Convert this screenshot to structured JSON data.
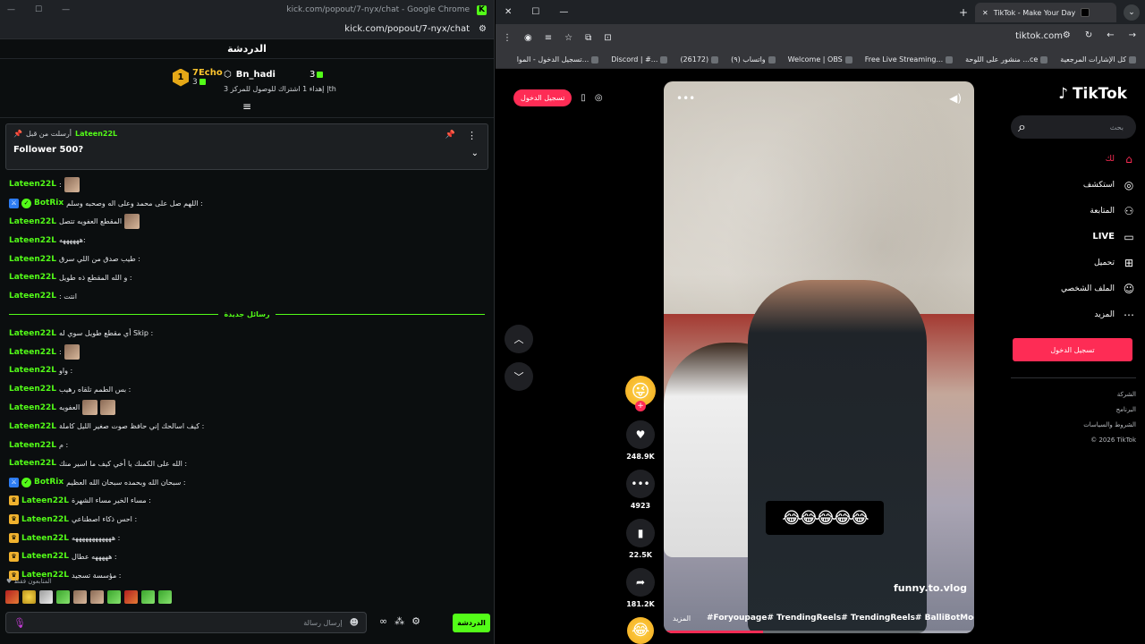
{
  "left": {
    "titlebar": {
      "url_title": "kick.com/popout/7-nyx/chat - Google Chrome",
      "favicon": "K"
    },
    "urlbar": {
      "url": "kick.com/popout/7-nyx/chat"
    },
    "header": {
      "title": "الدردشة"
    },
    "leaderboard": {
      "first": {
        "rank": "1",
        "name": "7Echo",
        "count": "3"
      },
      "second": {
        "name": "Bn_hadi"
      },
      "third": {
        "count": "3"
      },
      "info": "إهداء 1 اشتراك للوصول للمركز 3 |th"
    },
    "pinned": {
      "label": "أرسلت من قبل",
      "user": "Lateen22L",
      "message": "Follower 500?"
    },
    "messages": [
      {
        "user": "Lateen22L",
        "text": ":",
        "emotes": 1
      },
      {
        "user": "BotRix",
        "text": "اللهم صل على محمد وعلى اله وصحبه وسلم :",
        "bot": true
      },
      {
        "user": "Lateen22L",
        "text": "المقطع العفويه تتصل ",
        "emotes": 1
      },
      {
        "user": "Lateen22L",
        "text": "ههههههه:"
      },
      {
        "user": "Lateen22L",
        "text": "طيب صدق من اللي سرق :"
      },
      {
        "user": "Lateen22L",
        "text": "و الله المقطع ذه طويل :"
      },
      {
        "user": "Lateen22L",
        "text": ": انتت"
      },
      {
        "divider": "رسائل جديدة"
      },
      {
        "user": "Lateen22L",
        "text": "أي مقطع طويل سوي له Skip :"
      },
      {
        "user": "Lateen22L",
        "text": ":",
        "emotes": 1
      },
      {
        "user": "Lateen22L",
        "text": "واو :"
      },
      {
        "user": "Lateen22L",
        "text": "بس الطمم تلقاه رهيب :"
      },
      {
        "user": "Lateen22L",
        "text": "العفويه ",
        "emotes": 2
      },
      {
        "user": "Lateen22L",
        "text": "كيف اسالحك إني حافظ صوت صغير الليل كاملة :"
      },
      {
        "user": "Lateen22L",
        "text": "م :"
      },
      {
        "user": "Lateen22L",
        "text": "الله على الكمنك يا أخي كيف ما اسير منك :"
      },
      {
        "user": "BotRix",
        "text": "سبحان الله وبحمده سبحان الله العظيم :",
        "bot": true
      },
      {
        "user": "Lateen22L",
        "text": "مساء الخير مساء الشهرة :",
        "crown": true
      },
      {
        "user": "Lateen22L",
        "text": "احس ذكاء اصطناعي :",
        "crown": true
      },
      {
        "user": "Lateen22L",
        "text": "ههههههههههههه :",
        "crown": true
      },
      {
        "user": "Lateen22L",
        "text": "هههههه عطال :",
        "crown": true
      },
      {
        "user": "Lateen22L",
        "text": "مؤسسة تسجيد :",
        "crown": true
      }
    ],
    "subs_only": "المتابعون فقط",
    "input_placeholder": "إرسال رسالة",
    "send_label": "الدردشة"
  },
  "right": {
    "tab": {
      "title": "TikTok - Make Your Day"
    },
    "url": "tiktok.com",
    "bookmarks": [
      "تسجيل الدخول - الموا...",
      "Discord | #...",
      "(26172)",
      "(٩) واتساب",
      "Welcome | OBS",
      "Free Live Streaming...",
      "منشور على اللوحة ...ce",
      "كل الإشارات المرجعية"
    ],
    "top_login": "تسجيل الدخول",
    "video": {
      "emojis": "😂😂😂😂😂",
      "handle": "funny.to.vlog",
      "caption": "#Foryoupage# TrendingReels# TrendingReels# BalliBotMogis# ...",
      "more": "المزيد",
      "progress": 0.32
    },
    "actions": {
      "likes": "248.9K",
      "comments": "4923",
      "saves": "22.5K",
      "shares": "181.2K"
    },
    "sidebar": {
      "logo": "TikTok",
      "search_placeholder": "بحث",
      "nav": [
        {
          "label": "لك",
          "icon": "home-icon"
        },
        {
          "label": "استكشف",
          "icon": "compass-icon"
        },
        {
          "label": "المتابعة",
          "icon": "user-plus-icon"
        },
        {
          "label": "LIVE",
          "icon": "live-icon"
        },
        {
          "label": "تحميل",
          "icon": "upload-icon"
        },
        {
          "label": "الملف الشخصي",
          "icon": "profile-icon"
        },
        {
          "label": "المزيد",
          "icon": "more-icon"
        }
      ],
      "login": "تسجيل الدخول",
      "links": [
        "الشركة",
        "البرنامج",
        "الشروط والسياسات",
        "© 2026 TikTok"
      ]
    }
  }
}
